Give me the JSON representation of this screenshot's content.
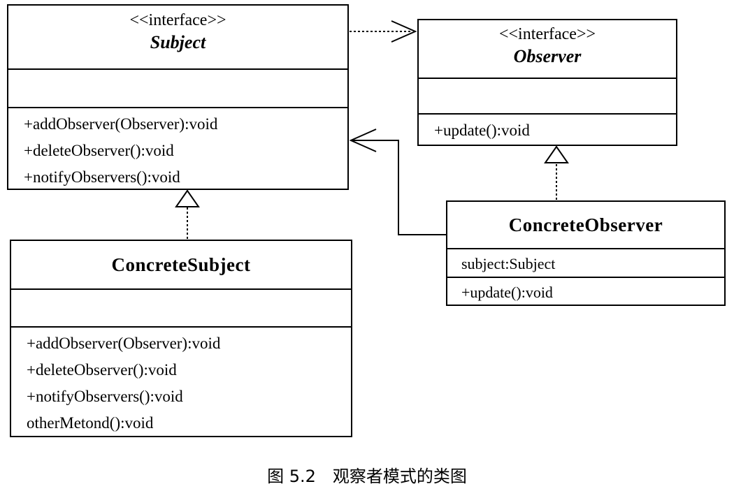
{
  "subject": {
    "stereotype": "<<interface>>",
    "name": "Subject",
    "operations": [
      "+addObserver(Observer):void",
      "+deleteObserver():void",
      "+notifyObservers():void"
    ]
  },
  "observer": {
    "stereotype": "<<interface>>",
    "name": "Observer",
    "operations": [
      "+update():void"
    ]
  },
  "concrete_subject": {
    "name": "ConcreteSubject",
    "operations": [
      "+addObserver(Observer):void",
      "+deleteObserver():void",
      "+notifyObservers():void",
      "otherMetond():void"
    ]
  },
  "concrete_observer": {
    "name": "ConcreteObserver",
    "attributes": [
      "subject:Subject"
    ],
    "operations": [
      "+update():void"
    ]
  },
  "caption": "图 5.2　观察者模式的类图"
}
